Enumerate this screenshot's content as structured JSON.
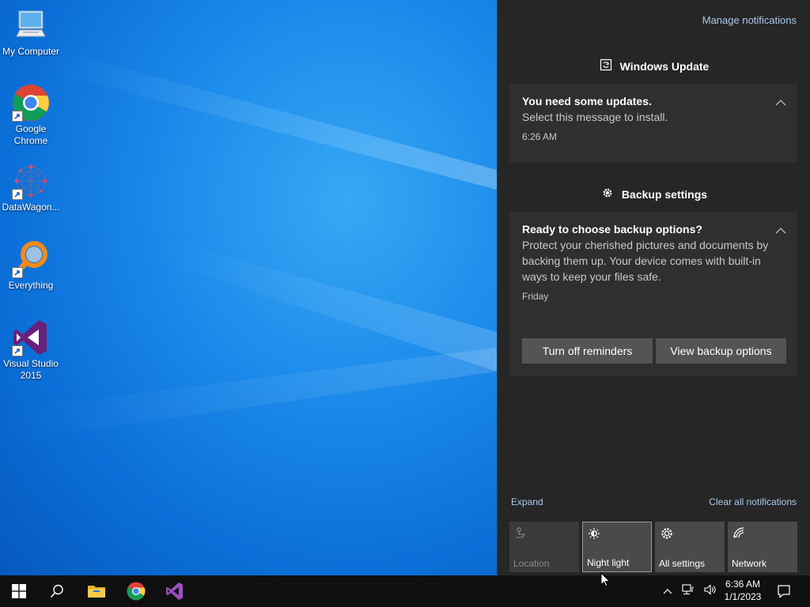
{
  "desktop": {
    "icons": [
      {
        "label": "My Computer",
        "icon": "computer-icon"
      },
      {
        "label": "Google Chrome",
        "icon": "chrome-icon"
      },
      {
        "label": "DataWagon...",
        "icon": "datawagon-icon"
      },
      {
        "label": "Everything",
        "icon": "everything-search-icon"
      },
      {
        "label": "Visual Studio 2015",
        "icon": "visual-studio-icon"
      }
    ]
  },
  "action_center": {
    "manage_label": "Manage notifications",
    "groups": [
      {
        "app": "Windows Update",
        "icon": "windows-update-icon",
        "notification": {
          "title": "You need some updates.",
          "body": "Select this message to install.",
          "time": "6:26 AM"
        }
      },
      {
        "app": "Backup settings",
        "icon": "gear-icon",
        "notification": {
          "title": "Ready to choose backup options?",
          "body": "Protect your cherished pictures and documents by backing them up. Your device comes with built-in ways to keep your files safe.",
          "time": "Friday",
          "buttons": [
            "Turn off reminders",
            "View backup options"
          ]
        }
      }
    ],
    "expand_label": "Expand",
    "clear_label": "Clear all notifications",
    "quick_actions": [
      {
        "label": "Location",
        "icon": "location-icon",
        "state": "disabled"
      },
      {
        "label": "Night light",
        "icon": "night-light-icon",
        "state": "hover"
      },
      {
        "label": "All settings",
        "icon": "gear-icon",
        "state": "normal"
      },
      {
        "label": "Network",
        "icon": "network-icon",
        "state": "normal"
      }
    ]
  },
  "taskbar": {
    "pinned": [
      "start-button",
      "search-icon",
      "file-explorer-icon",
      "chrome-icon",
      "visual-studio-icon"
    ],
    "clock_time": "6:36 AM",
    "clock_date": "1/1/2023"
  },
  "colors": {
    "action_center_bg": "#262626",
    "card_bg": "#2f2f2f",
    "link": "#a9c9ec",
    "taskbar_bg": "#101010"
  }
}
